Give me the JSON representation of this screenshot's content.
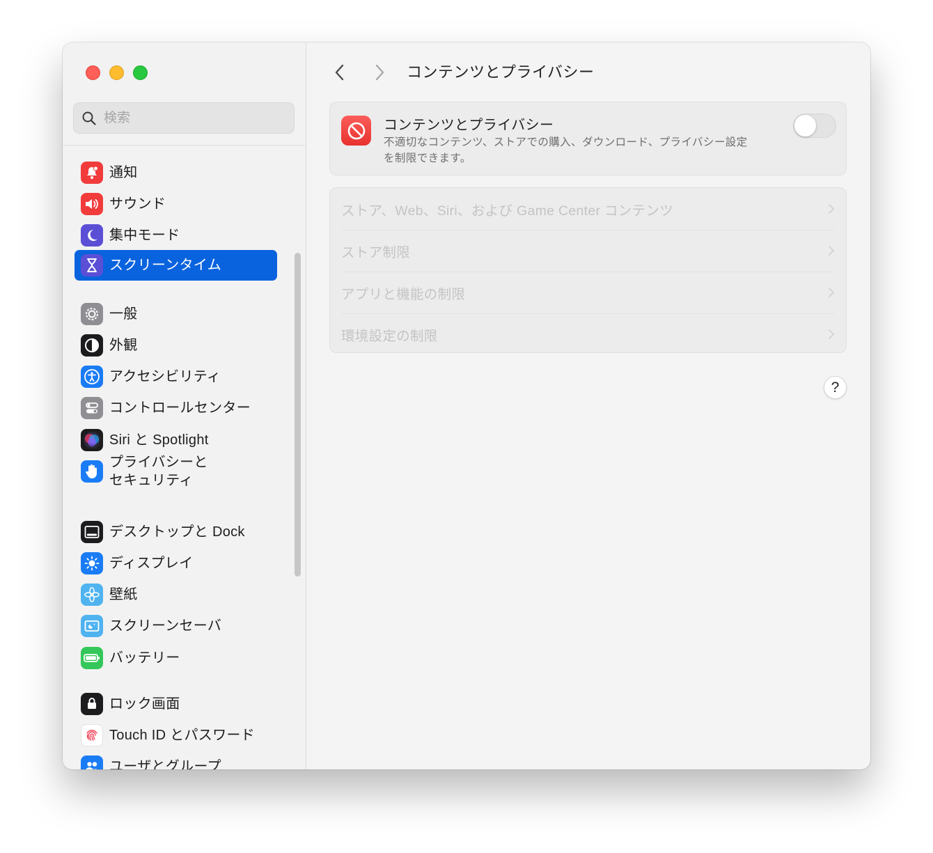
{
  "search": {
    "placeholder": "検索"
  },
  "sidebar": {
    "items": [
      {
        "label": "通知",
        "icon": "bell-icon",
        "color": "#f23c3c"
      },
      {
        "label": "サウンド",
        "icon": "speaker-icon",
        "color": "#f23c3c"
      },
      {
        "label": "集中モード",
        "icon": "moon-icon",
        "color": "#5b4fd6"
      },
      {
        "label": "スクリーンタイム",
        "icon": "hourglass-icon",
        "color": "#5b4fd6",
        "selected": true
      },
      {
        "label": "一般",
        "icon": "gear-icon",
        "color": "#8e8e93"
      },
      {
        "label": "外観",
        "icon": "appearance-icon",
        "color": "#1c1c1e"
      },
      {
        "label": "アクセシビリティ",
        "icon": "accessibility-icon",
        "color": "#1a7cf5"
      },
      {
        "label": "コントロールセンター",
        "icon": "control-center-icon",
        "color": "#8e8e93"
      },
      {
        "label": "Siri と Spotlight",
        "icon": "siri-icon",
        "color": "#1c1c1e"
      },
      {
        "label_line1": "プライバシーと",
        "label_line2": "セキュリティ",
        "icon": "hand-icon",
        "color": "#1a7cf5"
      },
      {
        "label": "デスクトップと Dock",
        "icon": "dock-icon",
        "color": "#1c1c1e"
      },
      {
        "label": "ディスプレイ",
        "icon": "sun-icon",
        "color": "#1a7cf5"
      },
      {
        "label": "壁紙",
        "icon": "flower-icon",
        "color": "#4fb3f0"
      },
      {
        "label": "スクリーンセーバ",
        "icon": "screensaver-icon",
        "color": "#4fb3f0"
      },
      {
        "label": "バッテリー",
        "icon": "battery-icon",
        "color": "#34c759"
      },
      {
        "label": "ロック画面",
        "icon": "lock-icon",
        "color": "#1c1c1e"
      },
      {
        "label": "Touch ID とパスワード",
        "icon": "fingerprint-icon",
        "color": "#ffffff"
      },
      {
        "label": "ユーザとグループ",
        "icon": "users-icon",
        "color": "#1a7cf5"
      }
    ]
  },
  "main": {
    "title": "コンテンツとプライバシー",
    "card": {
      "title": "コンテンツとプライバシー",
      "description_line1": "不適切なコンテンツ、ストアでの購入、ダウンロード、プライバシー設定",
      "description_line2": "を制限できます。",
      "toggle_on": false,
      "icon": "prohibited-icon"
    },
    "rows": [
      {
        "label": "ストア、Web、Siri、および Game Center コンテンツ"
      },
      {
        "label": "ストア制限"
      },
      {
        "label": "アプリと機能の制限"
      },
      {
        "label": "環境設定の制限"
      }
    ],
    "help": "?"
  }
}
